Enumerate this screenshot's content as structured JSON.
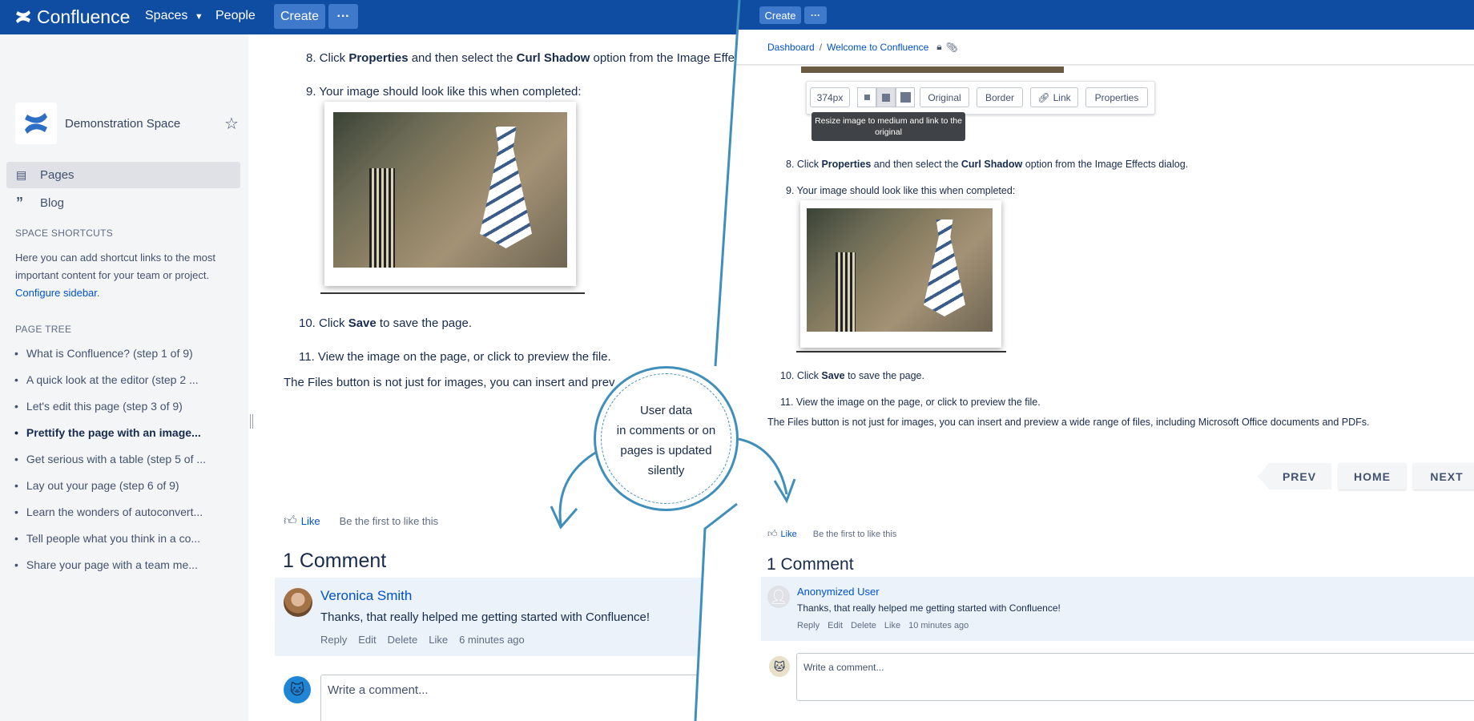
{
  "app": {
    "brand": "Confluence",
    "nav": {
      "spaces": "Spaces",
      "people": "People",
      "create": "Create",
      "more": "···"
    }
  },
  "sidebar": {
    "space_name": "Demonstration Space",
    "links": [
      {
        "label": "Pages",
        "icon": "pages-icon"
      },
      {
        "label": "Blog",
        "icon": "quote-icon"
      }
    ],
    "shortcuts_heading": "SPACE SHORTCUTS",
    "shortcuts_text": "Here you can add shortcut links to the most important content for your team or project.",
    "configure_link": "Configure sidebar",
    "tree_heading": "PAGE TREE",
    "tree": [
      "What is Confluence? (step 1 of 9)",
      "A quick look at the editor (step 2 ...",
      "Let's edit this page (step 3 of 9)",
      "Prettify the page with an image...",
      "Get serious with a table (step 5 of ...",
      "Lay out your page (step 6 of 9)",
      "Learn the wonders of autoconvert...",
      "Tell people what you think in a co...",
      "Share your page with a team me..."
    ]
  },
  "left_page": {
    "step8_pre": "8. Click ",
    "step8_b1": "Properties",
    "step8_mid": " and then select the ",
    "step8_b2": "Curl Shadow",
    "step8_post": " option from the Image Effe",
    "step9": "9. Your image should look like this when completed:",
    "step10_pre": "10. Click ",
    "step10_b": "Save",
    "step10_post": " to save the page.",
    "step11": "11. View the image on the page, or click to preview the file.",
    "files_note": "The Files button is not just for images, you can insert and prev",
    "like": "Like",
    "like_note": "Be the first to like this",
    "comments_title": "1 Comment",
    "comment": {
      "author": "Veronica Smith",
      "body": "Thanks, that really helped me getting started with Confluence!",
      "actions": [
        "Reply",
        "Edit",
        "Delete",
        "Like",
        "6 minutes ago"
      ]
    },
    "write_placeholder": "Write a comment..."
  },
  "right_page": {
    "nav": {
      "create": "Create",
      "more": "···"
    },
    "breadcrumb": [
      "Dashboard",
      "Welcome to Confluence"
    ],
    "toolbar": {
      "size": "374px",
      "buttons": [
        "Original",
        "Border",
        "Link",
        "Properties"
      ],
      "tooltip": "Resize image to medium and link to the original"
    },
    "step8_pre": "8. Click ",
    "step8_b1": "Properties",
    "step8_mid": " and then select the ",
    "step8_b2": "Curl Shadow",
    "step8_post": " option from the Image Effects dialog.",
    "step9": "9. Your image should look like this when completed:",
    "step10_pre": "10. Click ",
    "step10_b": "Save",
    "step10_post": " to save the page.",
    "step11": "11. View the image on the page, or click to preview the file.",
    "files_note": "The Files button is not just for images, you can insert and preview a wide range of files, including Microsoft Office documents and PDFs.",
    "pager": [
      "PREV",
      "HOME",
      "NEXT"
    ],
    "like": "Like",
    "like_note": "Be the first to like this",
    "comments_title": "1 Comment",
    "comment": {
      "author": "Anonymized User",
      "body": "Thanks, that really helped me getting started with Confluence!",
      "actions": [
        "Reply",
        "Edit",
        "Delete",
        "Like",
        "10 minutes ago"
      ]
    },
    "write_placeholder": "Write a comment..."
  },
  "callout": {
    "lines": [
      "User data",
      "in comments or on",
      "pages is updated",
      "silently"
    ]
  },
  "colors": {
    "brand": "#0f4da3",
    "accent": "#3f8fba",
    "link": "#0052cc"
  }
}
